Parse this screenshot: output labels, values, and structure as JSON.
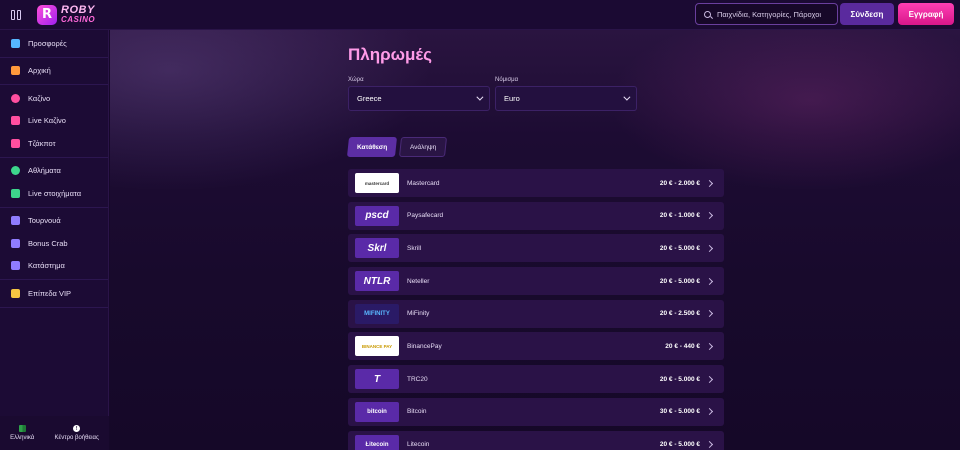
{
  "brand": {
    "logo_line1": "ROBY",
    "logo_line2": "CASINO",
    "badge": "R"
  },
  "header": {
    "search_placeholder": "Παιχνίδια, Κατηγορίες, Πάροχοι",
    "login_label": "Σύνδεση",
    "register_label": "Εγγραφή"
  },
  "sidebar": {
    "groups": [
      [
        {
          "label": "Προσφορές",
          "icon": "gift-icon",
          "color": "#56b6ff"
        }
      ],
      [
        {
          "label": "Αρχική",
          "icon": "home-icon",
          "color": "#ff9a3c"
        }
      ],
      [
        {
          "label": "Καζίνο",
          "icon": "chip-icon",
          "color": "#ff4fa0"
        },
        {
          "label": "Live Καζίνο",
          "icon": "microphone-icon",
          "color": "#ff4fa0"
        },
        {
          "label": "Τζάκποτ",
          "icon": "seven-icon",
          "color": "#ff4fa0"
        }
      ],
      [
        {
          "label": "Αθλήματα",
          "icon": "soccer-ball-icon",
          "color": "#3dd68c"
        },
        {
          "label": "Live στοιχήματα",
          "icon": "ticket-icon",
          "color": "#3dd68c"
        }
      ],
      [
        {
          "label": "Τουρνουά",
          "icon": "trophy-icon",
          "color": "#8f7cff"
        },
        {
          "label": "Bonus Crab",
          "icon": "crab-icon",
          "color": "#8f7cff"
        },
        {
          "label": "Κατάστημα",
          "icon": "cart-icon",
          "color": "#8f7cff"
        }
      ],
      [
        {
          "label": "Επίπεδα VIP",
          "icon": "crown-icon",
          "color": "#f5c542"
        }
      ]
    ],
    "footer": {
      "language_label": "Ελληνικά",
      "help_label": "Κέντρο βοήθειας"
    }
  },
  "main": {
    "title": "Πληρωμές",
    "country": {
      "label": "Χώρα",
      "value": "Greece"
    },
    "currency": {
      "label": "Νόμισμα",
      "value": "Euro"
    },
    "tabs": [
      {
        "label": "Κατάθεση",
        "active": true
      },
      {
        "label": "Ανάληψη",
        "active": false
      }
    ],
    "payments": [
      {
        "name": "Mastercard",
        "range": "20 € - 2.000 €",
        "logo": "mastercard",
        "logo_bg": "#ffffff",
        "logo_color": "#333333"
      },
      {
        "name": "Paysafecard",
        "range": "20 € - 1.000 €",
        "logo": "pscd",
        "logo_bg": "#5a2aa8",
        "logo_color": "#ffffff"
      },
      {
        "name": "Skrill",
        "range": "20 € - 5.000 €",
        "logo": "Skrl",
        "logo_bg": "#5a2aa8",
        "logo_color": "#ffffff"
      },
      {
        "name": "Neteller",
        "range": "20 € - 5.000 €",
        "logo": "NTLR",
        "logo_bg": "#5a2aa8",
        "logo_color": "#ffffff"
      },
      {
        "name": "MiFinity",
        "range": "20 € - 2.500 €",
        "logo": "MIFINITY",
        "logo_bg": "#2a1a66",
        "logo_color": "#5ab8ff"
      },
      {
        "name": "BinancePay",
        "range": "20 € - 440 €",
        "logo": "BINANCE PAY",
        "logo_bg": "#ffffff",
        "logo_color": "#c99a00"
      },
      {
        "name": "TRC20",
        "range": "20 € - 5.000 €",
        "logo": "T",
        "logo_bg": "#5a2aa8",
        "logo_color": "#ffffff"
      },
      {
        "name": "Bitcoin",
        "range": "30 € - 5.000 €",
        "logo": "bitcoin",
        "logo_bg": "#5a2aa8",
        "logo_color": "#ffffff"
      },
      {
        "name": "Litecoin",
        "range": "20 € - 5.000 €",
        "logo": "Łitecoin",
        "logo_bg": "#5a2aa8",
        "logo_color": "#ffffff"
      }
    ]
  },
  "colors": {
    "accent_pink": "#ff9be8",
    "register_button": "#e0208f",
    "login_button": "#5a2a9e",
    "row_bg": "#2a1247"
  }
}
